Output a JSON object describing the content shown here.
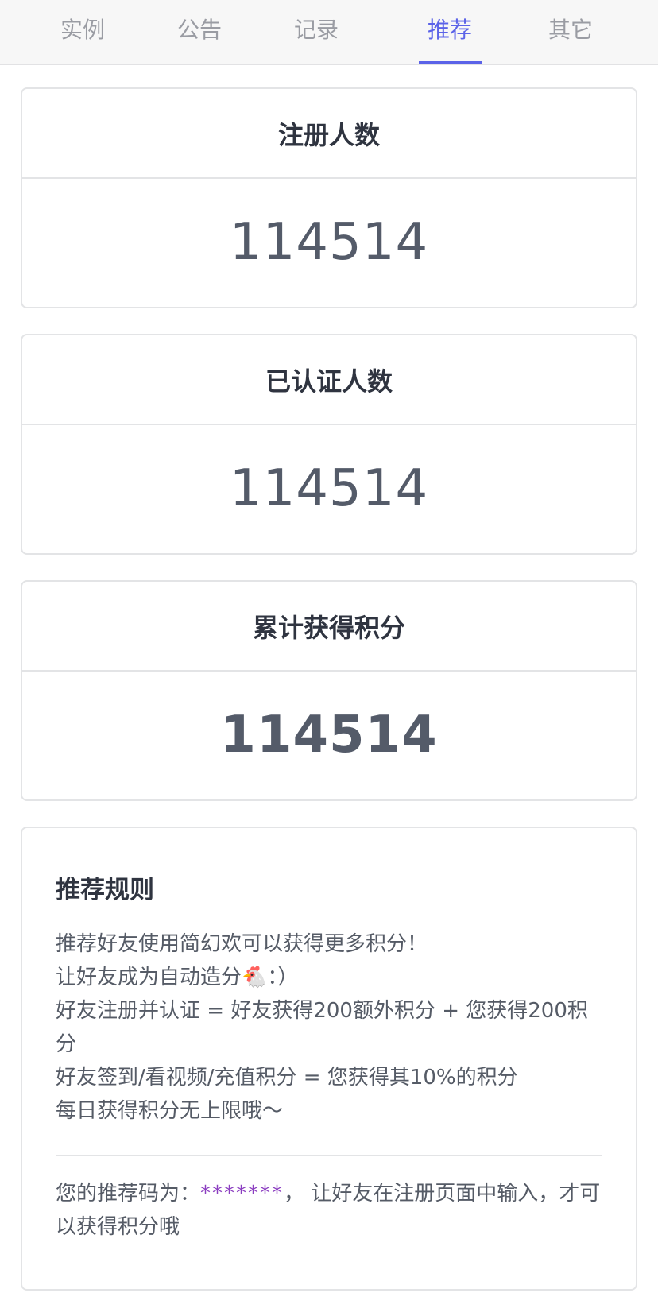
{
  "tabs": [
    {
      "label": "实例"
    },
    {
      "label": "公告"
    },
    {
      "label": "记录"
    },
    {
      "label": "推荐",
      "active": true
    },
    {
      "label": "其它"
    }
  ],
  "stats": [
    {
      "title": "注册人数",
      "value": "114514"
    },
    {
      "title": "已认证人数",
      "value": "114514"
    },
    {
      "title": "累计获得积分",
      "value": "114514"
    }
  ],
  "rules": {
    "title": "推荐规则",
    "lines": [
      "推荐好友使用简幻欢可以获得更多积分！",
      "让好友成为自动造分🐔：）",
      "好友注册并认证 = 好友获得200额外积分 + 您获得200积分",
      "好友签到/看视频/充值积分 = 您获得其10%的积分",
      "每日获得积分无上限哦～"
    ],
    "code_prefix": "您的推荐码为：",
    "code": "*******",
    "code_suffix": "，  让好友在注册页面中输入，才可以获得积分哦"
  },
  "colors": {
    "accent": "#5b63e8",
    "code": "#8c3fc1"
  }
}
